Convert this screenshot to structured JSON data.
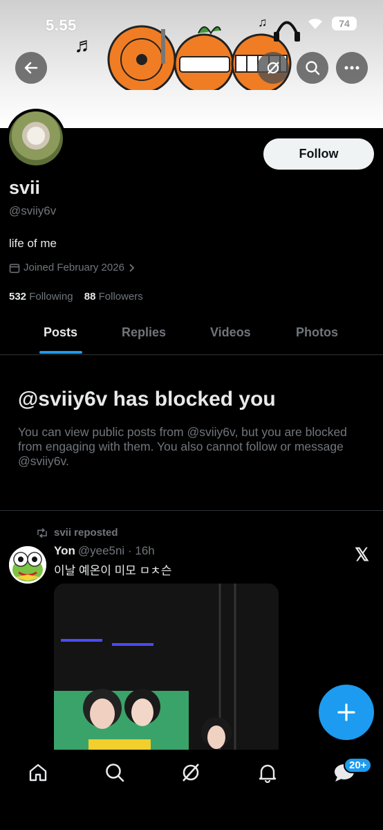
{
  "status_bar": {
    "time": "5.55",
    "battery": "74"
  },
  "profile": {
    "name": "svii",
    "handle": "@sviiy6v",
    "bio": "life of me",
    "joined": "Joined February 2026",
    "following_count": "532",
    "following_label": "Following",
    "followers_count": "88",
    "followers_label": "Followers",
    "follow_button": "Follow"
  },
  "tabs": [
    {
      "label": "Posts",
      "active": true
    },
    {
      "label": "Replies",
      "active": false
    },
    {
      "label": "Videos",
      "active": false
    },
    {
      "label": "Photos",
      "active": false
    }
  ],
  "blocked": {
    "title": "@sviiy6v has blocked you",
    "body": "You can view public posts from @sviiy6v, but you are blocked from engaging with them. You also cannot follow or message @sviiy6v."
  },
  "post": {
    "repost_label": "svii reposted",
    "author_name": "Yon",
    "author_handle": "@yee5ni",
    "time": "16h",
    "separator": "·",
    "text": "이날 예온이 미모 ㅁㅊ슨"
  },
  "nav": {
    "messages_badge": "20+"
  },
  "icons": [
    "back-arrow-icon",
    "grok-icon",
    "search-icon",
    "more-icon",
    "calendar-icon",
    "chevron-right-icon",
    "repost-icon",
    "x-logo-icon",
    "plus-icon",
    "home-icon",
    "search-icon",
    "grok-icon",
    "bell-icon",
    "messages-icon"
  ],
  "colors": {
    "accent": "#1d9bf0",
    "background": "#000000",
    "secondary_text": "#71767b",
    "primary_text": "#e7e9ea"
  }
}
